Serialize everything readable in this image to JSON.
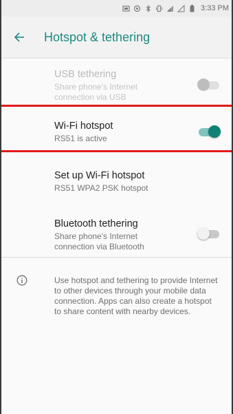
{
  "status_bar": {
    "time": "3:33 PM",
    "icons": [
      "sim-icon",
      "alarm-icon",
      "bluetooth-icon",
      "vibrate-icon",
      "wifi-icon",
      "signal-icon",
      "battery-icon"
    ]
  },
  "header": {
    "title": "Hotspot & tethering",
    "accent_color": "#1c8a80"
  },
  "items": [
    {
      "title": "USB tethering",
      "subtitle": "Share phone's Internet connection via USB",
      "toggle_state": "off",
      "enabled": false
    },
    {
      "title": "Wi-Fi hotspot",
      "subtitle": "RS51 is active",
      "toggle_state": "on",
      "enabled": true
    },
    {
      "title": "Set up Wi-Fi hotspot",
      "subtitle": "RS51 WPA2 PSK hotspot",
      "enabled": true
    },
    {
      "title": "Bluetooth tethering",
      "subtitle": "Share phone's Internet connection via Bluetooth",
      "toggle_state": "off",
      "enabled": true
    }
  ],
  "info": {
    "text": "Use hotspot and tethering to provide Internet to other devices through your mobile data connection. Apps can also create a hotspot to share content with nearby devices."
  },
  "annotation_color": "#e21a1a"
}
